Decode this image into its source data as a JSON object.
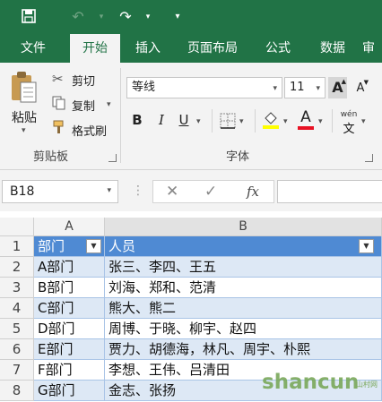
{
  "tabs": [
    "文件",
    "开始",
    "插入",
    "页面布局",
    "公式",
    "数据",
    "审"
  ],
  "active_tab": "开始",
  "clipboard": {
    "paste": "粘贴",
    "cut": "剪切",
    "copy": "复制",
    "format_painter": "格式刷",
    "group_label": "剪贴板"
  },
  "font": {
    "name": "等线",
    "size": "11",
    "group_label": "字体",
    "bold": "B",
    "italic": "I",
    "underline": "U",
    "grow": "A",
    "shrink": "A",
    "font_color_letter": "A",
    "phonetic": "wén"
  },
  "formula_bar": {
    "name_box": "B18",
    "fx": "fx"
  },
  "columns": [
    "A",
    "B"
  ],
  "rows": [
    {
      "num": "1",
      "a": "部门",
      "b": "人员"
    },
    {
      "num": "2",
      "a": "A部门",
      "b": "张三、李四、王五"
    },
    {
      "num": "3",
      "a": "B部门",
      "b": "刘海、郑和、范清"
    },
    {
      "num": "4",
      "a": "C部门",
      "b": "熊大、熊二"
    },
    {
      "num": "5",
      "a": "D部门",
      "b": "周博、于晓、柳宇、赵四"
    },
    {
      "num": "6",
      "a": "E部门",
      "b": "贾力、胡德海，林凡、周宇、朴熙"
    },
    {
      "num": "7",
      "a": "F部门",
      "b": "李想、王伟、吕清田"
    },
    {
      "num": "8",
      "a": "G部门",
      "b": "金志、张扬"
    }
  ],
  "watermark": {
    "text": "shancun",
    "sub": "山村网"
  },
  "colors": {
    "accent": "#217346",
    "table_header": "#4f8ad3",
    "band": "#dde8f5",
    "font_color": "#e81123",
    "highlight": "#ffff00"
  }
}
